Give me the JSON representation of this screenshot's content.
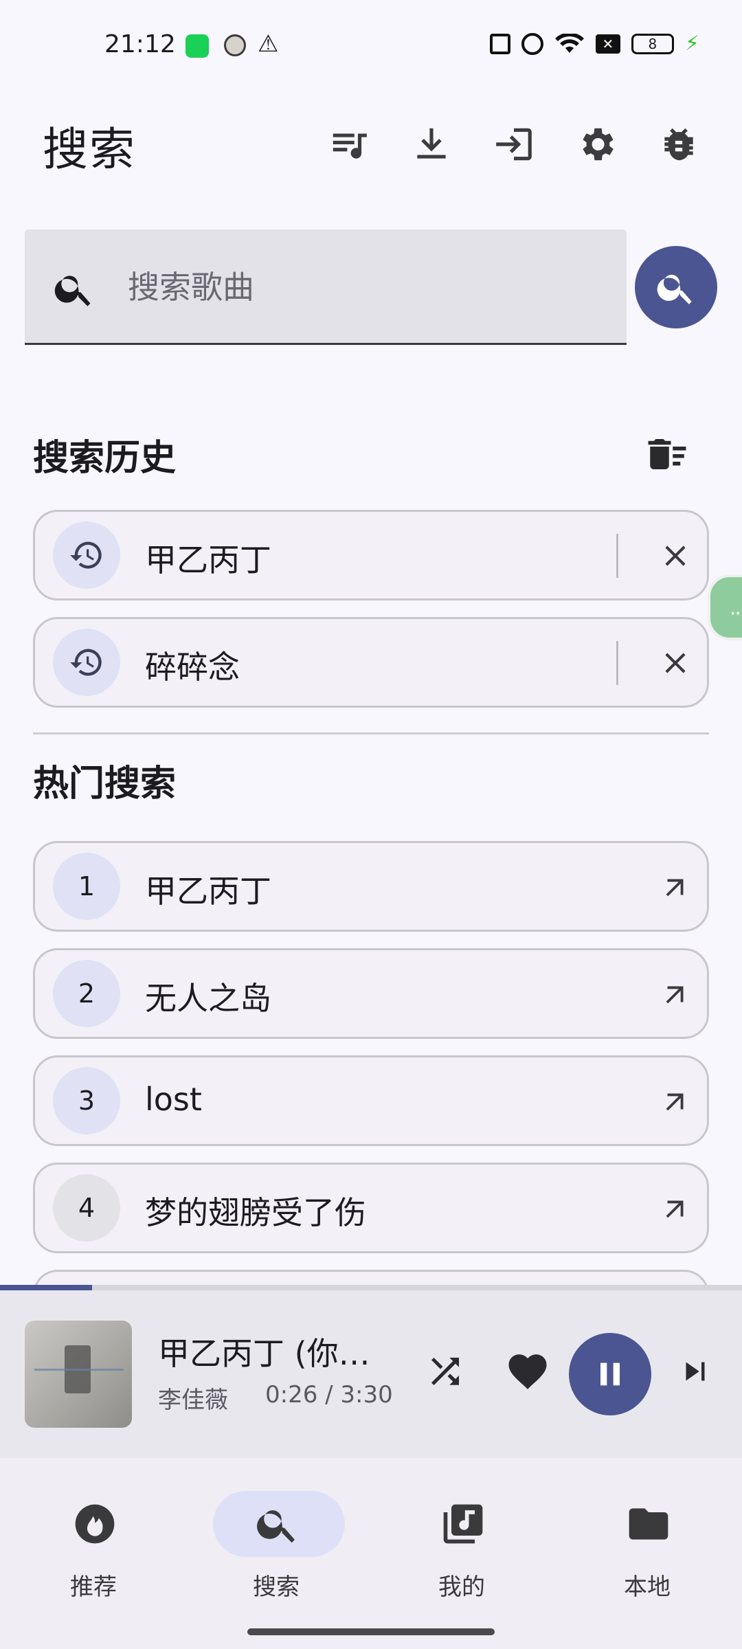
{
  "status_bar": {
    "time": "21:12",
    "battery": "8",
    "icons": [
      "app-notification-icon",
      "avatar-icon",
      "warning-icon",
      "nfc-icon",
      "alarm-icon",
      "wifi-icon",
      "sim-off-icon",
      "battery-icon",
      "charging-icon"
    ]
  },
  "header": {
    "title": "搜索",
    "actions": [
      "playlist-icon",
      "download-icon",
      "login-icon",
      "settings-icon",
      "debug-icon"
    ]
  },
  "search": {
    "placeholder": "搜索歌曲"
  },
  "history": {
    "title": "搜索历史",
    "items": [
      {
        "text": "甲乙丙丁"
      },
      {
        "text": "碎碎念"
      }
    ]
  },
  "hot": {
    "title": "热门搜索",
    "items": [
      {
        "rank": "1",
        "text": "甲乙丙丁"
      },
      {
        "rank": "2",
        "text": "无人之岛"
      },
      {
        "rank": "3",
        "text": "lost"
      },
      {
        "rank": "4",
        "text": "梦的翅膀受了伤"
      }
    ]
  },
  "player": {
    "title": "甲乙丙丁 (你我有时…",
    "artist": "李佳薇",
    "time": "0:26 / 3:30",
    "progress": 0.124,
    "accent": "#4b5592"
  },
  "nav": {
    "items": [
      {
        "label": "推荐"
      },
      {
        "label": "搜索"
      },
      {
        "label": "我的"
      },
      {
        "label": "本地"
      }
    ],
    "active": 1
  }
}
